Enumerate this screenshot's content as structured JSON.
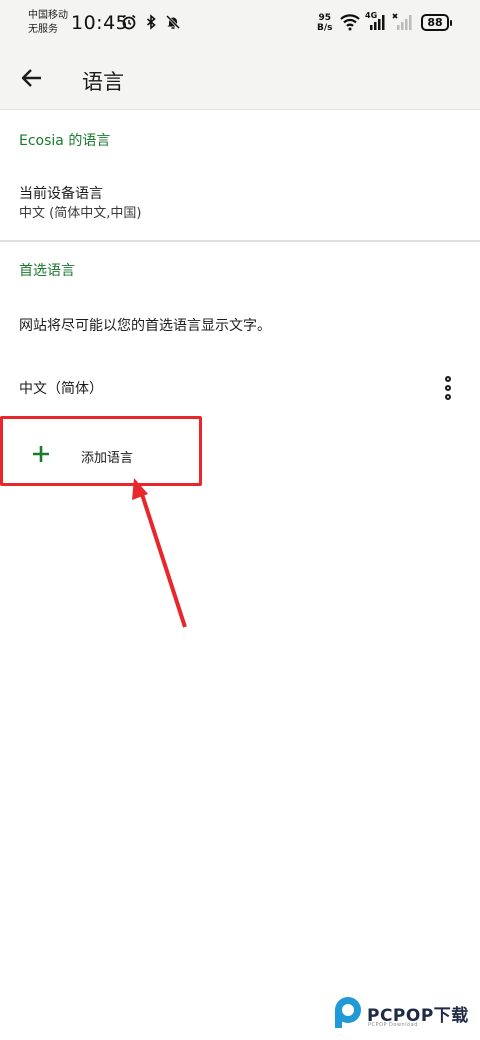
{
  "status_bar": {
    "carrier_line1": "中国移动",
    "carrier_line2": "无服务",
    "time": "10:45",
    "net_speed_value": "95",
    "net_speed_unit": "B/s",
    "network_type": "4G",
    "battery": "88",
    "icons": [
      "alarm-icon",
      "bluetooth-icon",
      "mute-icon",
      "wifi-icon",
      "signal-icon",
      "no-signal-icon"
    ]
  },
  "app_bar": {
    "title": "语言",
    "back_icon": "arrow-back-icon"
  },
  "sections": {
    "ecosia_language": {
      "header": "Ecosia 的语言",
      "current_device_title": "当前设备语言",
      "current_device_value": "中文 (简体中文,中国)"
    },
    "preferred_language": {
      "header": "首选语言",
      "description": "网站将尽可能以您的首选语言显示文字。",
      "languages": [
        "中文（简体）"
      ],
      "add_language_label": "添加语言"
    }
  },
  "colors": {
    "accent": "#1a7a2e",
    "annotation": "#e8262c",
    "app_bar_bg": "#f4f4f2"
  },
  "watermark": {
    "text": "PCPOP下载",
    "sub": "PCPOP Download"
  }
}
